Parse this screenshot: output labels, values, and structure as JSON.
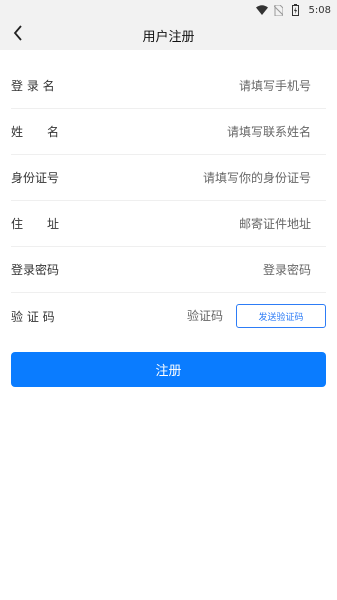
{
  "status_bar": {
    "time": "5:08",
    "icons": [
      "wifi-icon",
      "no-sim-icon",
      "battery-icon"
    ]
  },
  "nav": {
    "title": "用户注册",
    "back_icon": "chevron-left-icon"
  },
  "form": {
    "fields": [
      {
        "label": "登 录 名",
        "placeholder": "请填写手机号"
      },
      {
        "label": "姓　　名",
        "placeholder": "请填写联系姓名"
      },
      {
        "label": "身份证号",
        "placeholder": "请填写你的身份证号"
      },
      {
        "label": "住　　址",
        "placeholder": "邮寄证件地址"
      },
      {
        "label": "登录密码",
        "placeholder": "登录密码"
      },
      {
        "label": "验 证 码",
        "placeholder": "验证码"
      }
    ],
    "send_code_label": "发送验证码",
    "submit_label": "注册"
  },
  "colors": {
    "accent": "#0a7cff",
    "link": "#2d7cf6",
    "header_bg": "#f2f2f2"
  }
}
